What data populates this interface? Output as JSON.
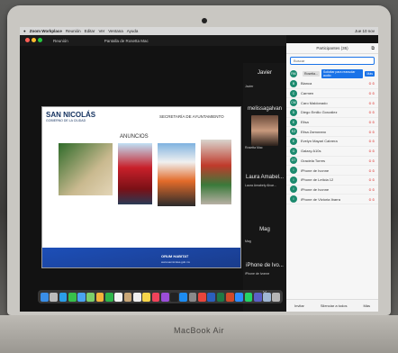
{
  "menubar": {
    "app": "Zoom Workplace",
    "items": [
      "Reunión",
      "Editar",
      "Ver",
      "Ventana",
      "Ayuda"
    ],
    "status": "Jue 10 nov"
  },
  "zoom_top": {
    "left_label": "Reunión",
    "screen_label": "Pantalla de Rosetta Mac"
  },
  "slide": {
    "brand_title": "SAN NICOLÁS",
    "brand_subtitle": "GOBIERNO DE LA CIUDAD",
    "header": "SECRETARÍA DE AYUNTAMIENTO",
    "section": "ANUNCIOS",
    "footer_logo": "ORUM HABITAT",
    "footer_url": "www.sannicolas.gob.mx"
  },
  "strip": {
    "tiles": [
      {
        "name": "Javier",
        "sub": "Javier"
      },
      {
        "name": "melissagalvan",
        "sub": "Rosetta Mac"
      },
      {
        "name": "Laura Amabel...",
        "sub": "Laura Amabely Alvar..."
      },
      {
        "name": "Mag",
        "sub": "Mag"
      },
      {
        "name": "iPhone de Ivo...",
        "sub": "iPhone de Ivonne"
      }
    ],
    "more_label": "v"
  },
  "participants": {
    "title": "Participantes (35)",
    "search_placeholder": "Buscar",
    "host_badge": "Rosetta...",
    "unmute_button": "Solicitar para reanudar audio",
    "more_button": "Más",
    "list": [
      {
        "initials": "B",
        "name": "Blanca"
      },
      {
        "initials": "C",
        "name": "Carmen"
      },
      {
        "initials": "CM",
        "name": "Caro Maldonado"
      },
      {
        "initials": "D",
        "name": "Diego Emilio González"
      },
      {
        "initials": "E",
        "name": "Elisa"
      },
      {
        "initials": "EZ",
        "name": "Elisa Zamorano"
      },
      {
        "initials": "E",
        "name": "Evelyn Mayari Cabrera"
      },
      {
        "initials": "G",
        "name": "Galaxy A10s"
      },
      {
        "initials": "GT",
        "name": "Graciela Torres"
      },
      {
        "initials": "I",
        "name": "iPhone de Ivonne"
      },
      {
        "initials": "I",
        "name": "iPhone de Leticia 12"
      },
      {
        "initials": "I",
        "name": "iPhone de Ivonne"
      },
      {
        "initials": "I",
        "name": "iPhone de Victoria Ibarra"
      }
    ],
    "footer": {
      "invite": "Invitar",
      "mute_all": "Silenciar a todos",
      "more": "Más"
    }
  },
  "laptop_brand": "MacBook Air",
  "colors": {
    "zoom_blue": "#1a73e8",
    "slide_blue": "#1d4fb8",
    "avatar_green": "#1c8a6e",
    "muted_red": "#e0403c"
  }
}
